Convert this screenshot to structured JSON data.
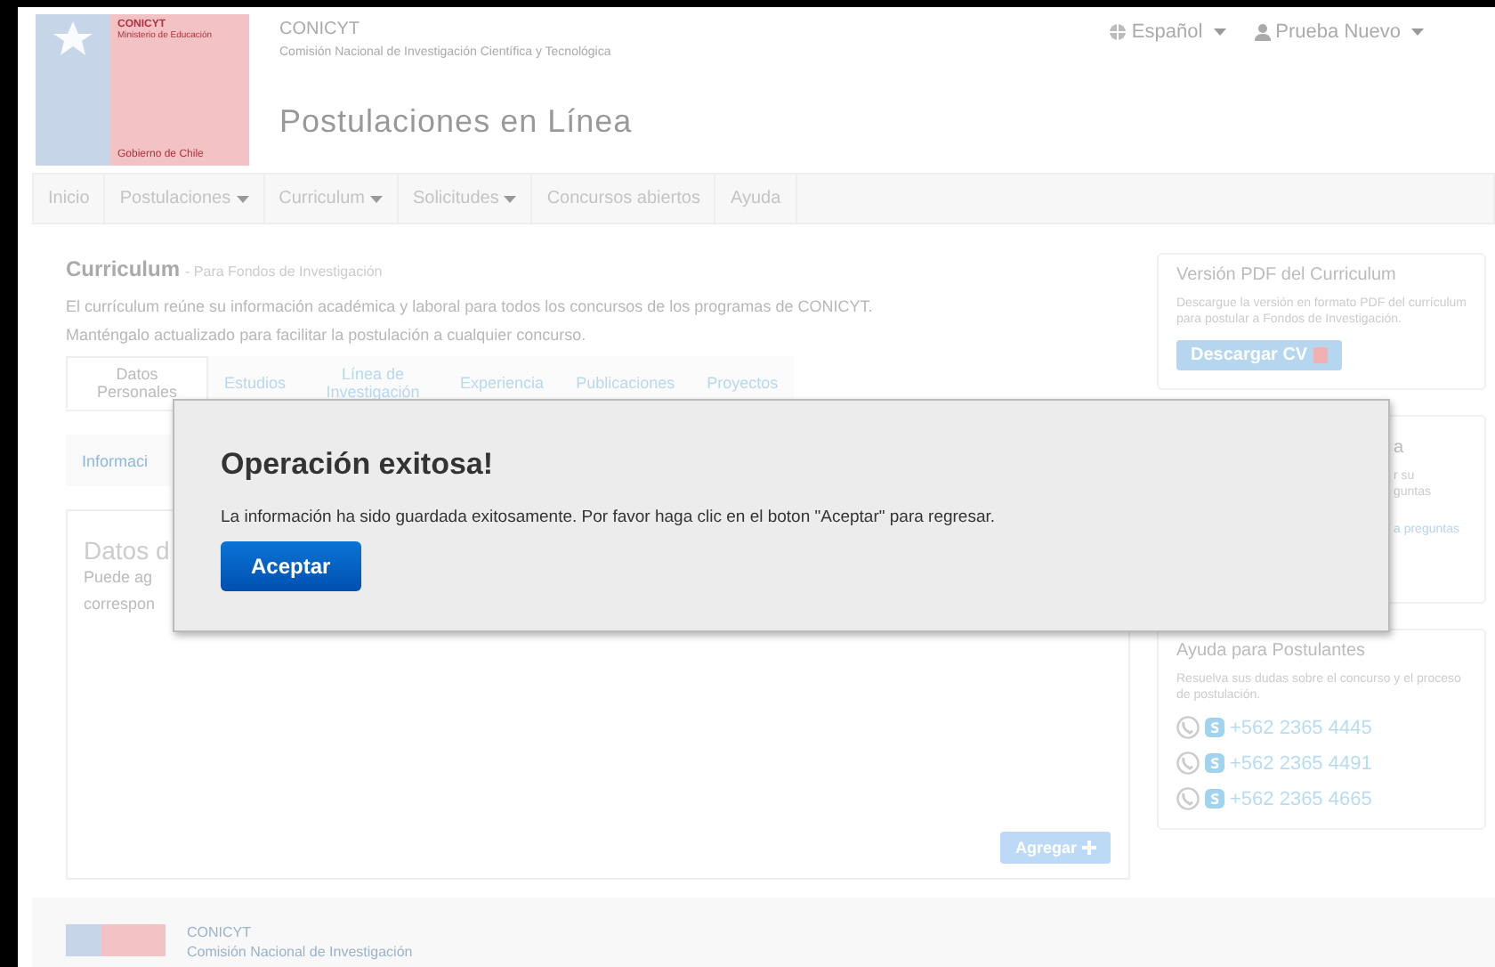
{
  "logo": {
    "org": "CONICYT",
    "ministry": "Ministerio de Educación",
    "government": "Gobierno de Chile"
  },
  "header": {
    "org": "CONICYT",
    "subtitle": "Comisión Nacional de Investigación Científica y Tecnológica",
    "title": "Postulaciones en Línea",
    "language": "Español",
    "user": "Prueba Nuevo"
  },
  "nav": [
    {
      "label": "Inicio",
      "has_menu": false
    },
    {
      "label": "Postulaciones",
      "has_menu": true
    },
    {
      "label": "Curriculum",
      "has_menu": true
    },
    {
      "label": "Solicitudes",
      "has_menu": true
    },
    {
      "label": "Concursos abiertos",
      "has_menu": false
    },
    {
      "label": "Ayuda",
      "has_menu": false
    }
  ],
  "page": {
    "title": "Curriculum",
    "subtitle": "- Para Fondos de Investigación",
    "description": "El currículum reúne su información académica y laboral para todos los concursos de los programas de CONICYT. Manténgalo actualizado para facilitar la postulación a cualquier concurso."
  },
  "tabs": [
    {
      "label": "Datos Personales",
      "selected": true
    },
    {
      "label": "Estudios",
      "selected": false
    },
    {
      "label": "Línea de Investigación",
      "selected": false
    },
    {
      "label": "Experiencia",
      "selected": false
    },
    {
      "label": "Publicaciones",
      "selected": false
    },
    {
      "label": "Proyectos",
      "selected": false
    }
  ],
  "subtab": "Informaci",
  "section": {
    "title": "Datos d",
    "lines": [
      "Puede ag",
      "correspon"
    ],
    "add_button": "Agregar"
  },
  "sidebar": {
    "pdf": {
      "title": "Versión PDF del Curriculum",
      "text": "Descargue la versión en formato PDF del currículum para postular a Fondos de Investigación.",
      "button": "Descargar CV"
    },
    "faq": {
      "title": "a",
      "lines": [
        "r su",
        "guntas"
      ],
      "link": "a preguntas"
    },
    "help": {
      "title": "Ayuda para Postulantes",
      "text": "Resuelva sus dudas sobre el concurso y el proceso de postulación.",
      "phones": [
        "+562 2365 4445",
        "+562 2365 4491",
        "+562 2365 4665"
      ]
    }
  },
  "modal": {
    "title": "Operación exitosa!",
    "message": "La información ha sido guardada exitosamente. Por favor haga clic en el boton \"Aceptar\" para regresar.",
    "button": "Aceptar"
  },
  "footer": {
    "org": "CONICYT",
    "subtitle": "Comisión Nacional de Investigación"
  }
}
